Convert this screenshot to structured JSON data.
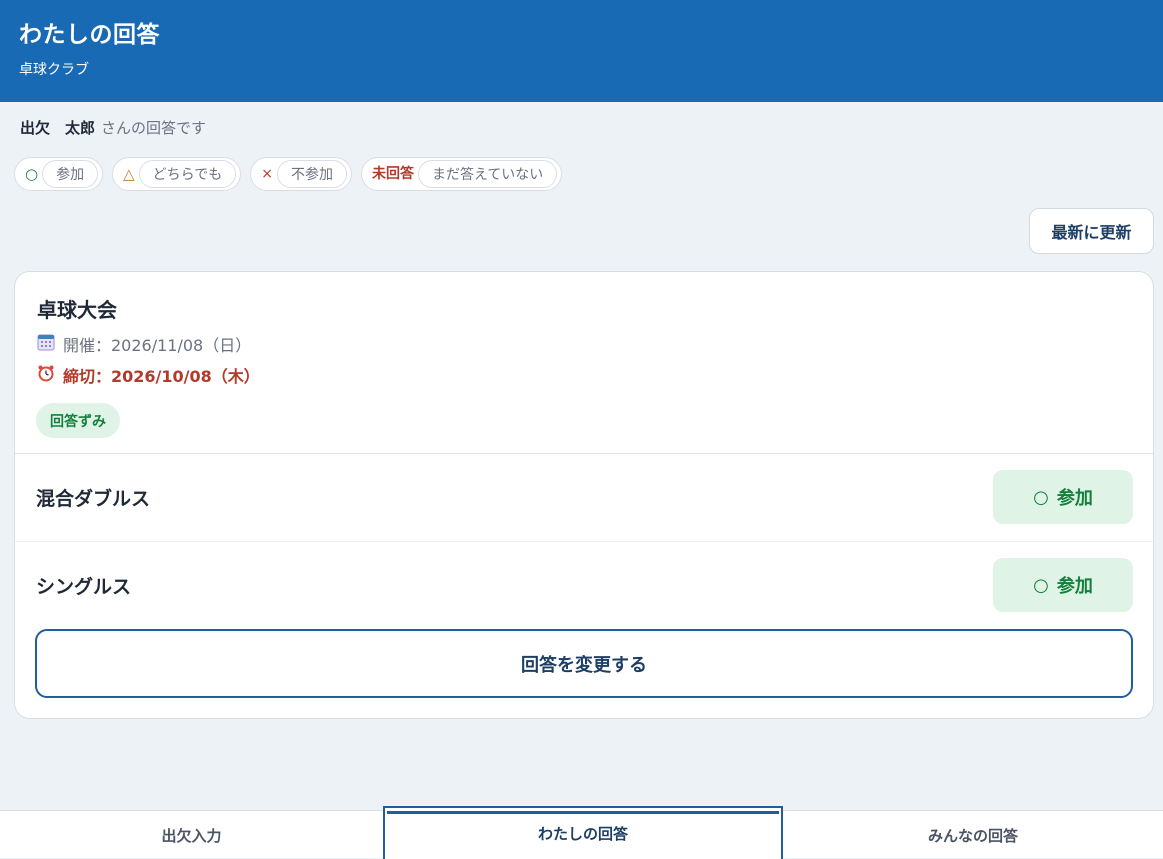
{
  "header": {
    "title": "わたしの回答",
    "subtitle": "卓球クラブ"
  },
  "owner": {
    "name": "出欠　太郎",
    "suffix": "さんの回答です"
  },
  "legend": [
    {
      "symbol": "○",
      "label": "参加"
    },
    {
      "symbol": "△",
      "label": "どちらでも"
    },
    {
      "symbol": "×",
      "label": "不参加"
    },
    {
      "symbol": "未回答",
      "label": "まだ答えていない"
    }
  ],
  "refresh_label": "最新に更新",
  "event": {
    "title": "卓球大会",
    "date_text": "開催：2026/11/08（日）",
    "deadline_text": "締切：2026/10/08（木）",
    "status": "回答ずみ",
    "items": [
      {
        "name": "混合ダブルス",
        "answer_symbol": "○",
        "answer_label": "参加"
      },
      {
        "name": "シングルス",
        "answer_symbol": "○",
        "answer_label": "参加"
      }
    ],
    "change_label": "回答を変更する"
  },
  "tabs": [
    {
      "label": "出欠入力"
    },
    {
      "label": "わたしの回答"
    },
    {
      "label": "みんなの回答"
    }
  ],
  "colors": {
    "header_bg": "#176ab3",
    "accent": "#1f5f9e",
    "yes_green": "#15803d",
    "deadline_red": "#b23a2b"
  }
}
